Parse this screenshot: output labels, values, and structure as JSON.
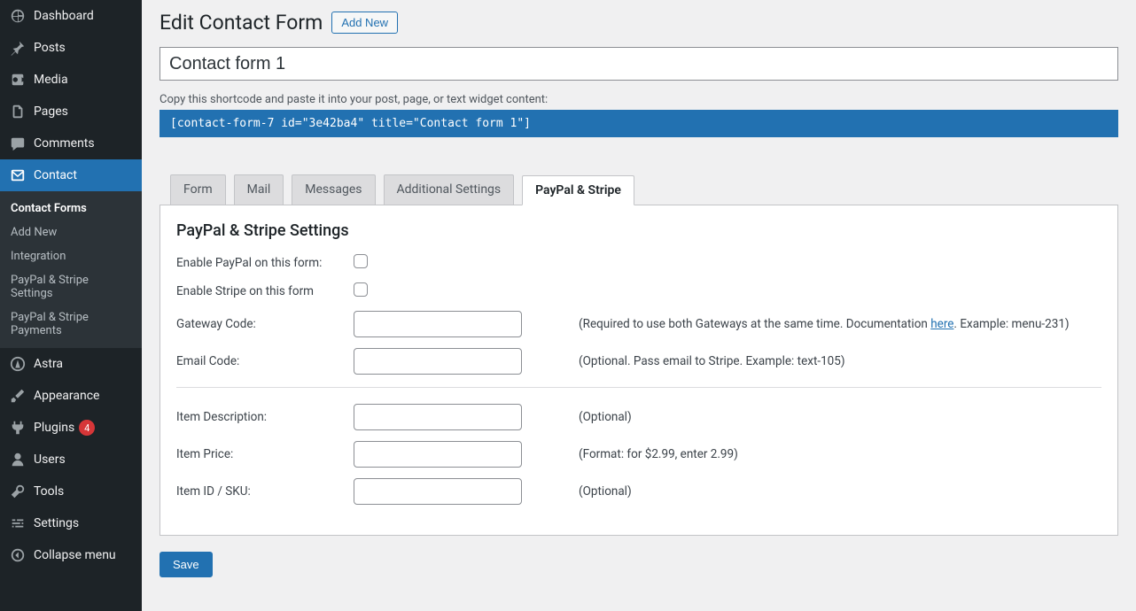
{
  "sidebar": {
    "items": [
      {
        "label": "Dashboard",
        "icon": "dashboard"
      },
      {
        "label": "Posts",
        "icon": "pin"
      },
      {
        "label": "Media",
        "icon": "media"
      },
      {
        "label": "Pages",
        "icon": "pages"
      },
      {
        "label": "Comments",
        "icon": "comment"
      },
      {
        "label": "Contact",
        "icon": "mail",
        "active": true
      },
      {
        "label": "Astra",
        "icon": "astra"
      },
      {
        "label": "Appearance",
        "icon": "brush"
      },
      {
        "label": "Plugins",
        "icon": "plugin",
        "badge": "4"
      },
      {
        "label": "Users",
        "icon": "user"
      },
      {
        "label": "Tools",
        "icon": "wrench"
      },
      {
        "label": "Settings",
        "icon": "sliders"
      },
      {
        "label": "Collapse menu",
        "icon": "collapse"
      }
    ],
    "submenu": [
      {
        "label": "Contact Forms",
        "current": true
      },
      {
        "label": "Add New"
      },
      {
        "label": "Integration"
      },
      {
        "label": "PayPal & Stripe Settings"
      },
      {
        "label": "PayPal & Stripe Payments"
      }
    ]
  },
  "header": {
    "title": "Edit Contact Form",
    "add_new": "Add New"
  },
  "form_title": "Contact form 1",
  "shortcode_hint": "Copy this shortcode and paste it into your post, page, or text widget content:",
  "shortcode": "[contact-form-7 id=\"3e42ba4\" title=\"Contact form 1\"]",
  "tabs": [
    {
      "label": "Form"
    },
    {
      "label": "Mail"
    },
    {
      "label": "Messages"
    },
    {
      "label": "Additional Settings"
    },
    {
      "label": "PayPal & Stripe",
      "active": true
    }
  ],
  "panel": {
    "heading": "PayPal & Stripe Settings",
    "enable_paypal_label": "Enable PayPal on this form:",
    "enable_stripe_label": "Enable Stripe on this form",
    "gateway_code_label": "Gateway Code:",
    "gateway_code_note_a": "(Required to use both Gateways at the same time. Documentation ",
    "gateway_code_note_link": "here",
    "gateway_code_note_b": ". Example: menu-231)",
    "email_code_label": "Email Code:",
    "email_code_note": "(Optional. Pass email to Stripe. Example: text-105)",
    "item_desc_label": "Item Description:",
    "item_desc_note": "(Optional)",
    "item_price_label": "Item Price:",
    "item_price_note": "(Format: for $2.99, enter 2.99)",
    "item_sku_label": "Item ID / SKU:",
    "item_sku_note": "(Optional)"
  },
  "save_label": "Save"
}
